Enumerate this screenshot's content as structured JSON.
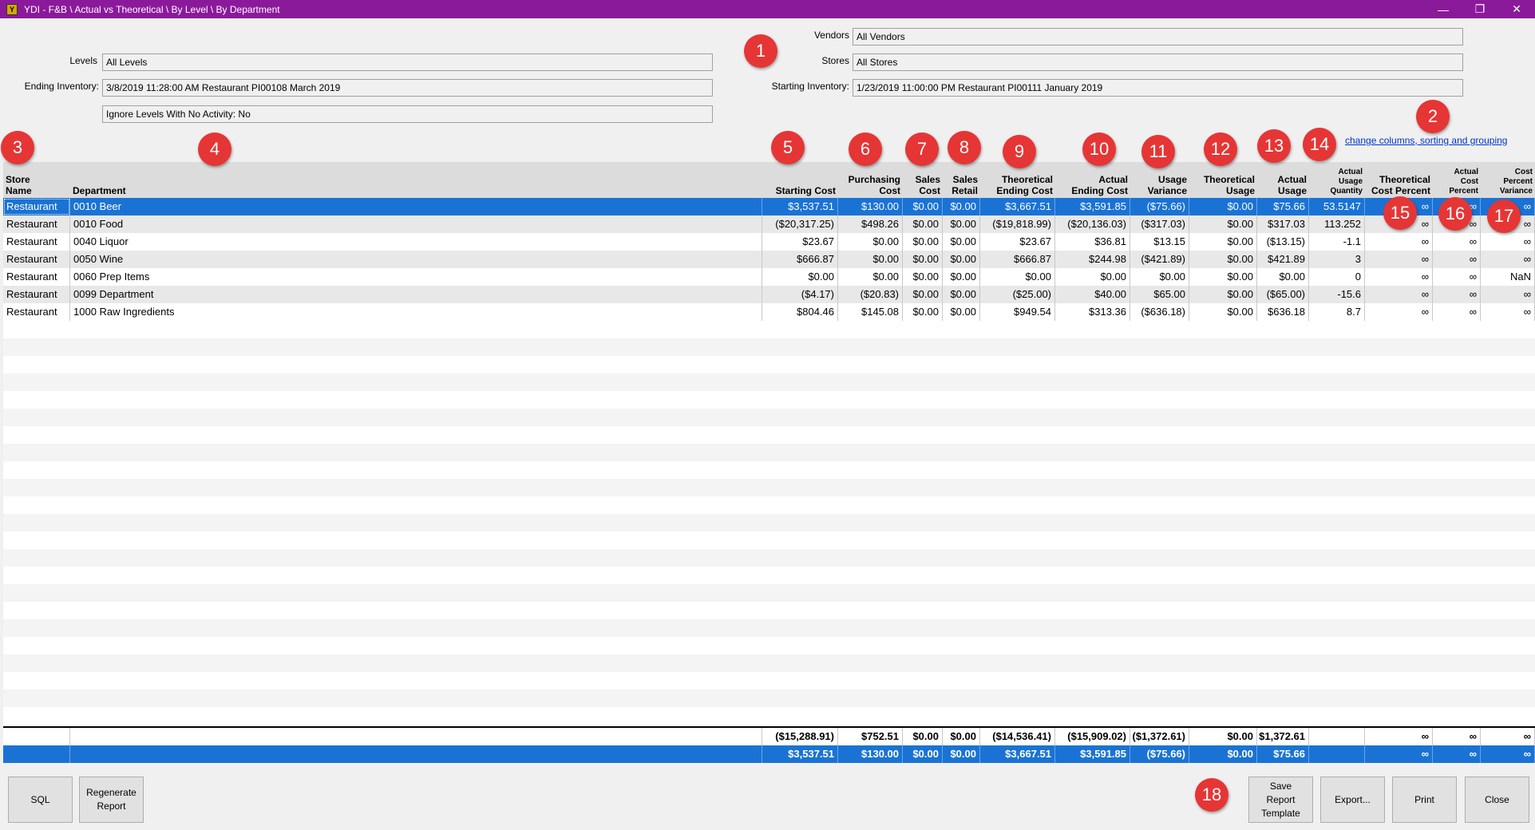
{
  "window": {
    "title": "YDI - F&B \\ Actual vs Theoretical \\ By Level \\ By Department",
    "minimize": "—",
    "restore": "❐",
    "close": "✕"
  },
  "filters": {
    "levels_label": "Levels",
    "levels_value": "All Levels",
    "ending_inventory_label": "Ending Inventory:",
    "ending_inventory_value": "3/8/2019 11:28:00 AM Restaurant PI00108 March 2019",
    "ignore_levels_value": "Ignore Levels With No Activity: No",
    "vendors_label": "Vendors",
    "vendors_value": "All Vendors",
    "stores_label": "Stores",
    "stores_value": "All Stores",
    "starting_inventory_label": "Starting Inventory:",
    "starting_inventory_value": "1/23/2019 11:00:00 PM Restaurant PI00111 January 2019"
  },
  "change_columns_link": "change columns, sorting and grouping",
  "columns": [
    {
      "l1": "Store",
      "l2": "Name"
    },
    {
      "l1": "",
      "l2": "Department"
    },
    {
      "l1": "",
      "l2": "Starting Cost"
    },
    {
      "l1": "Purchasing",
      "l2": "Cost"
    },
    {
      "l1": "Sales",
      "l2": "Cost"
    },
    {
      "l1": "Sales",
      "l2": "Retail"
    },
    {
      "l1": "Theoretical",
      "l2": "Ending Cost"
    },
    {
      "l1": "Actual",
      "l2": "Ending Cost"
    },
    {
      "l1": "Usage",
      "l2": "Variance"
    },
    {
      "l1": "Theoretical",
      "l2": "Usage"
    },
    {
      "l1": "Actual",
      "l2": "Usage"
    },
    {
      "l1": "Actual",
      "l2": "Usage",
      "l3": "Quantity"
    },
    {
      "l1": "Theoretical",
      "l2": "Cost Percent"
    },
    {
      "l1": "Actual",
      "l2": "Cost",
      "l3": "Percent"
    },
    {
      "l1": "Cost",
      "l2": "Percent",
      "l3": "Variance"
    }
  ],
  "rows": [
    [
      "Restaurant",
      "0010 Beer",
      "$3,537.51",
      "$130.00",
      "$0.00",
      "$0.00",
      "$3,667.51",
      "$3,591.85",
      "($75.66)",
      "$0.00",
      "$75.66",
      "53.5147",
      "∞",
      "∞",
      "∞"
    ],
    [
      "Restaurant",
      "0010 Food",
      "($20,317.25)",
      "$498.26",
      "$0.00",
      "$0.00",
      "($19,818.99)",
      "($20,136.03)",
      "($317.03)",
      "$0.00",
      "$317.03",
      "113.252",
      "∞",
      "∞",
      "∞"
    ],
    [
      "Restaurant",
      "0040 Liquor",
      "$23.67",
      "$0.00",
      "$0.00",
      "$0.00",
      "$23.67",
      "$36.81",
      "$13.15",
      "$0.00",
      "($13.15)",
      "-1.1",
      "∞",
      "∞",
      "∞"
    ],
    [
      "Restaurant",
      "0050 Wine",
      "$666.87",
      "$0.00",
      "$0.00",
      "$0.00",
      "$666.87",
      "$244.98",
      "($421.89)",
      "$0.00",
      "$421.89",
      "3",
      "∞",
      "∞",
      "∞"
    ],
    [
      "Restaurant",
      "0060 Prep Items",
      "$0.00",
      "$0.00",
      "$0.00",
      "$0.00",
      "$0.00",
      "$0.00",
      "$0.00",
      "$0.00",
      "$0.00",
      "0",
      "∞",
      "∞",
      "NaN"
    ],
    [
      "Restaurant",
      "0099 Department",
      "($4.17)",
      "($20.83)",
      "$0.00",
      "$0.00",
      "($25.00)",
      "$40.00",
      "$65.00",
      "$0.00",
      "($65.00)",
      "-15.6",
      "∞",
      "∞",
      "∞"
    ],
    [
      "Restaurant",
      "1000 Raw Ingredients",
      "$804.46",
      "$145.08",
      "$0.00",
      "$0.00",
      "$949.54",
      "$313.36",
      "($636.18)",
      "$0.00",
      "$636.18",
      "8.7",
      "∞",
      "∞",
      "∞"
    ]
  ],
  "totals": [
    [
      "",
      "",
      "($15,288.91)",
      "$752.51",
      "$0.00",
      "$0.00",
      "($14,536.41)",
      "($15,909.02)",
      "($1,372.61)",
      "$0.00",
      "$1,372.61",
      "",
      "∞",
      "∞",
      "∞"
    ],
    [
      "",
      "",
      "$3,537.51",
      "$130.00",
      "$0.00",
      "$0.00",
      "$3,667.51",
      "$3,591.85",
      "($75.66)",
      "$0.00",
      "$75.66",
      "",
      "∞",
      "∞",
      "∞"
    ]
  ],
  "buttons": {
    "sql": "SQL",
    "regenerate": "Regenerate\nReport",
    "save_template": "Save\nReport\nTemplate",
    "export": "Export...",
    "print": "Print",
    "close": "Close"
  },
  "callouts": [
    "1",
    "2",
    "3",
    "4",
    "5",
    "6",
    "7",
    "8",
    "9",
    "10",
    "11",
    "12",
    "13",
    "14",
    "15",
    "16",
    "17",
    "18"
  ],
  "colors": {
    "titlebar": "#8b1a9b",
    "selection": "#1a73d4",
    "callout": "#e63535",
    "link": "#0033cc"
  }
}
